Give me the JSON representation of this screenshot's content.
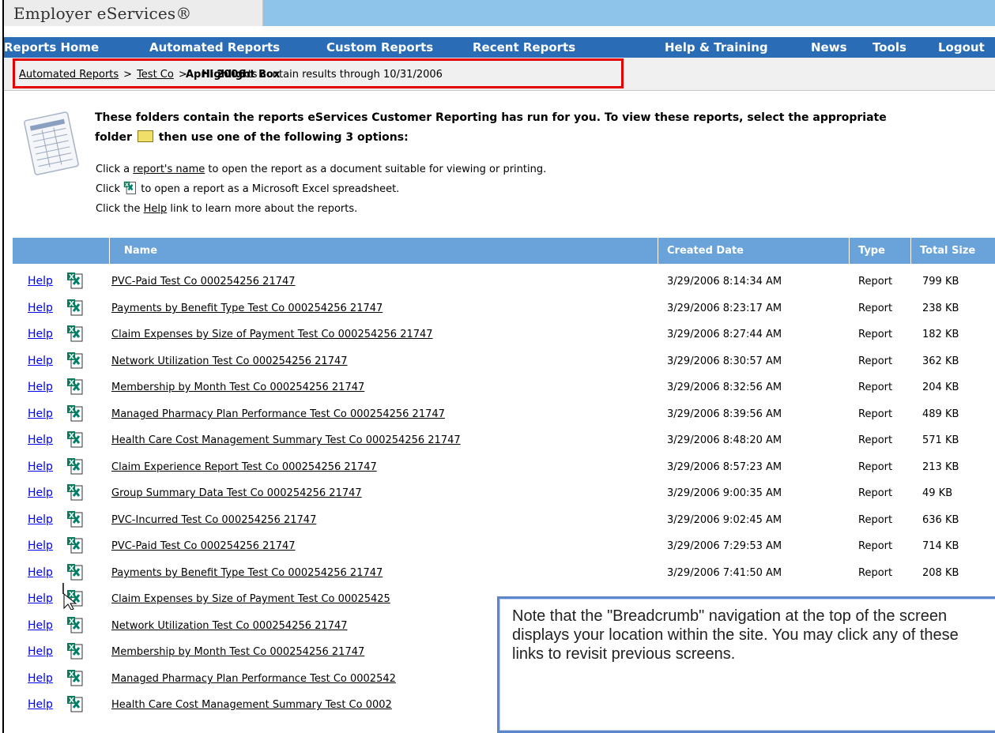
{
  "header": {
    "logo": "Employer eServices®"
  },
  "nav": {
    "items": [
      {
        "label": "Reports Home"
      },
      {
        "label": "Automated Reports"
      },
      {
        "label": "Custom Reports"
      },
      {
        "label": "Recent Reports"
      },
      {
        "label": "Help & Training"
      },
      {
        "label": "News"
      },
      {
        "label": "Tools"
      },
      {
        "label": "Logout"
      }
    ]
  },
  "breadcrumb": {
    "items": [
      "Automated Reports",
      "Test Co"
    ],
    "separator": ">",
    "current": "April 2006",
    "overlay_label": "Highlight Box",
    "note": "xts contain results through 10/31/2006"
  },
  "intro": {
    "bold_line1": "These folders contain the reports eServices Customer Reporting has run for you. To view these reports, select the appropriate",
    "bold_line2_pre": "folder",
    "bold_line2_post": "then use one of the following 3 options:",
    "line1_pre": "Click a ",
    "line1_link": "report's name",
    "line1_post": " to open the report as a document suitable for viewing or printing.",
    "line2_pre": "Click ",
    "line2_post": " to open a report as a Microsoft Excel spreadsheet.",
    "line3_pre": "Click the ",
    "line3_link": "Help",
    "line3_post": " link to learn more about the reports."
  },
  "table": {
    "columns": {
      "name": "Name",
      "created": "Created Date",
      "type": "Type",
      "size": "Total Size"
    },
    "help_label": "Help",
    "rows": [
      {
        "name": "PVC-Paid Test Co 000254256 21747",
        "created": "3/29/2006 8:14:34 AM",
        "type": "Report",
        "size": "799 KB"
      },
      {
        "name": "Payments by Benefit Type Test Co 000254256 21747",
        "created": "3/29/2006 8:23:17 AM",
        "type": "Report",
        "size": "238 KB"
      },
      {
        "name": "Claim Expenses by Size of Payment Test Co 000254256 21747",
        "created": "3/29/2006 8:27:44 AM",
        "type": "Report",
        "size": "182 KB"
      },
      {
        "name": "Network Utilization Test Co 000254256 21747",
        "created": "3/29/2006 8:30:57 AM",
        "type": "Report",
        "size": "362 KB"
      },
      {
        "name": "Membership by Month Test Co 000254256 21747",
        "created": "3/29/2006 8:32:56 AM",
        "type": "Report",
        "size": "204 KB"
      },
      {
        "name": "Managed Pharmacy Plan Performance Test Co 000254256 21747",
        "created": "3/29/2006 8:39:56 AM",
        "type": "Report",
        "size": "489 KB"
      },
      {
        "name": "Health Care Cost Management Summary Test Co 000254256 21747",
        "created": "3/29/2006 8:48:20 AM",
        "type": "Report",
        "size": "571 KB"
      },
      {
        "name": "Claim Experience Report Test Co 000254256 21747",
        "created": "3/29/2006 8:57:23 AM",
        "type": "Report",
        "size": "213 KB"
      },
      {
        "name": "Group Summary Data Test Co 000254256 21747",
        "created": "3/29/2006 9:00:35 AM",
        "type": "Report",
        "size": "49 KB"
      },
      {
        "name": "PVC-Incurred Test Co 000254256 21747",
        "created": "3/29/2006 9:02:45 AM",
        "type": "Report",
        "size": "636 KB"
      },
      {
        "name": "PVC-Paid Test Co 000254256 21747",
        "created": "3/29/2006 7:29:53 AM",
        "type": "Report",
        "size": "714 KB"
      },
      {
        "name": "Payments by Benefit Type Test Co 000254256 21747",
        "created": "3/29/2006 7:41:50 AM",
        "type": "Report",
        "size": "208 KB"
      },
      {
        "name": "Claim Expenses by Size of Payment Test Co 00025425",
        "created": "",
        "type": "",
        "size": ""
      },
      {
        "name": "Network Utilization Test Co 000254256 21747",
        "created": "",
        "type": "",
        "size": ""
      },
      {
        "name": "Membership by Month Test Co 000254256 21747",
        "created": "",
        "type": "",
        "size": ""
      },
      {
        "name": "Managed Pharmacy Plan Performance Test Co 0002542",
        "created": "",
        "type": "",
        "size": ""
      },
      {
        "name": "Health Care Cost Management Summary Test Co 0002",
        "created": "",
        "type": "",
        "size": ""
      }
    ]
  },
  "callout": {
    "text": "Note that the \"Breadcrumb\" navigation at the top of the screen displays your location within the site.  You may click any of these links to revisit previous screens."
  },
  "colors": {
    "nav_bg": "#2a6db6",
    "header_bg": "#8ec4ea",
    "table_header_bg": "#69a3d9",
    "highlight_border": "#e40000",
    "callout_border": "#5b86c9"
  }
}
